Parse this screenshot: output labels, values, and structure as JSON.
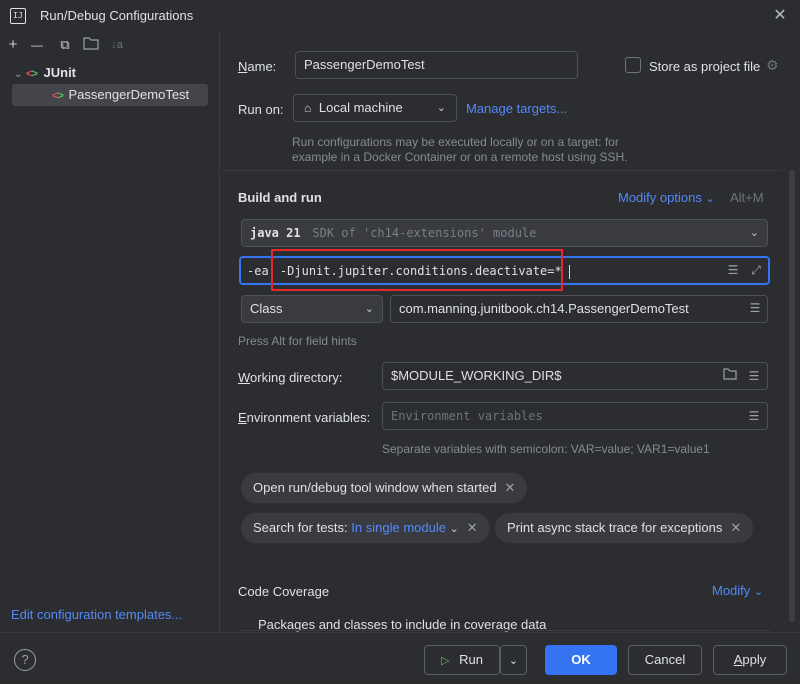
{
  "window": {
    "title": "Run/Debug Configurations",
    "app_icon": "IJ",
    "close": "✕"
  },
  "toolbar": {
    "add": "+",
    "remove": "—",
    "copy": "⧉",
    "folder": "📁",
    "sort": "↓a"
  },
  "tree": {
    "junit_label": "JUnit",
    "config_label": "PassengerDemoTest"
  },
  "left": {
    "edit_templates": "Edit configuration templates..."
  },
  "name": {
    "label": "Name:",
    "value": "PassengerDemoTest"
  },
  "store": {
    "label": "Store as project file"
  },
  "run_on": {
    "label": "Run on:",
    "value": "Local machine",
    "manage": "Manage targets...",
    "hint_line1": "Run configurations may be executed locally or on a target: for",
    "hint_line2": "example in a Docker Container or on a remote host using SSH."
  },
  "build": {
    "title": "Build and run",
    "modify": "Modify options",
    "shortcut": "Alt+M"
  },
  "jdk": {
    "version": "java 21",
    "detail": "SDK of 'ch14-extensions' module"
  },
  "vm_options": {
    "prefix": "-ea",
    "value": "-Djunit.jupiter.conditions.deactivate=*"
  },
  "test_kind": {
    "value": "Class"
  },
  "class_field": {
    "value": "com.manning.junitbook.ch14.PassengerDemoTest"
  },
  "field_hint": "Press Alt for field hints",
  "workdir": {
    "label": "Working directory:",
    "value": "$MODULE_WORKING_DIR$"
  },
  "env": {
    "label": "Environment variables:",
    "placeholder": "Environment variables",
    "hint": "Separate variables with semicolon: VAR=value; VAR1=value1"
  },
  "chips": {
    "open_tool": "Open run/debug tool window when started",
    "search_prefix": "Search for tests:",
    "search_value": "In single module",
    "async": "Print async stack trace for exceptions"
  },
  "coverage": {
    "title": "Code Coverage",
    "modify": "Modify",
    "packages": "Packages and classes to include in coverage data"
  },
  "buttons": {
    "help": "?",
    "run": "Run",
    "ok": "OK",
    "cancel": "Cancel",
    "apply": "Apply"
  },
  "colors": {
    "background": "#2b2d30",
    "accent": "#3574f0",
    "link": "#548af7",
    "highlight": "#e5272e",
    "field_focus": "#3574f0"
  }
}
